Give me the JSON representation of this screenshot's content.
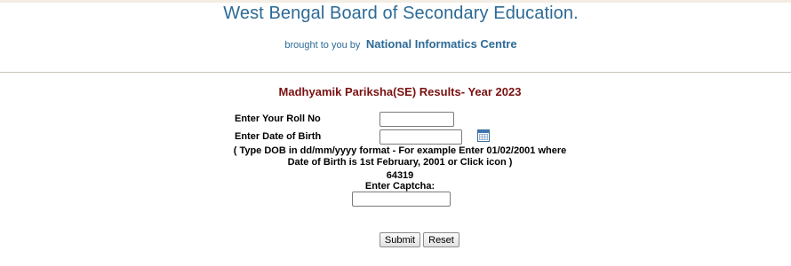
{
  "header": {
    "title": "West Bengal Board of Secondary Education.",
    "credit_prefix": "brought to you by",
    "credit_org": "National Informatics Centre"
  },
  "form": {
    "heading": "Madhyamik Pariksha(SE) Results- Year 2023",
    "roll_label": "Enter Your Roll No",
    "roll_value": "",
    "dob_label": "Enter Date of Birth",
    "dob_value": "",
    "calendar_icon": "calendar-icon",
    "hint": "( Type DOB in dd/mm/yyyy format - For example Enter 01/02/2001 where\nDate of Birth is 1st February, 2001 or Click icon   )",
    "captcha_code": "64319",
    "captcha_label": "Enter Captcha:",
    "captcha_value": "",
    "submit_label": "Submit",
    "reset_label": "Reset"
  },
  "colors": {
    "title": "#2c6a96",
    "heading": "#7a1010",
    "divider": "#c9c4bb"
  }
}
